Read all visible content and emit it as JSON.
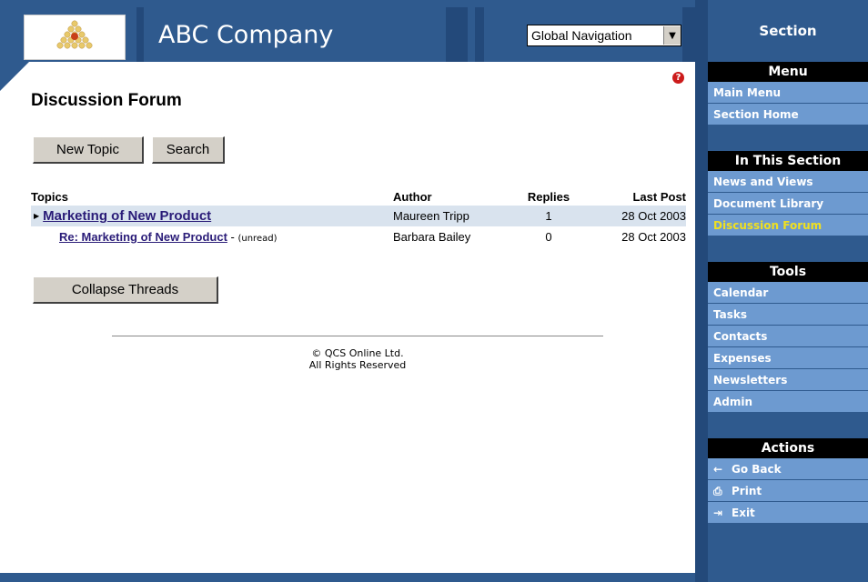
{
  "header": {
    "title": "ABC Company",
    "global_nav": {
      "selected": "Global Navigation"
    }
  },
  "page": {
    "title": "Discussion Forum",
    "buttons": {
      "new_topic": "New Topic",
      "search": "Search",
      "collapse": "Collapse Threads"
    }
  },
  "topics_table": {
    "headers": {
      "topics": "Topics",
      "author": "Author",
      "replies": "Replies",
      "last_post": "Last Post"
    },
    "rows": [
      {
        "title": "Marketing of New Product",
        "note": "",
        "author": "Maureen Tripp",
        "replies": "1",
        "last_post": "28 Oct 2003"
      },
      {
        "title": "Re: Marketing of New Product",
        "note": "(unread)",
        "author": "Barbara Bailey",
        "replies": "0",
        "last_post": "28 Oct 2003"
      }
    ]
  },
  "footer": {
    "line1": "© QCS Online Ltd.",
    "line2": "All Rights Reserved"
  },
  "sidebar": {
    "section": "Section",
    "menu": {
      "heading": "Menu",
      "items": [
        "Main Menu",
        "Section Home"
      ]
    },
    "in_section": {
      "heading": "In This Section",
      "items": [
        "News and Views",
        "Document Library",
        "Discussion Forum"
      ]
    },
    "tools": {
      "heading": "Tools",
      "items": [
        "Calendar",
        "Tasks",
        "Contacts",
        "Expenses",
        "Newsletters",
        "Admin"
      ]
    },
    "actions": {
      "heading": "Actions",
      "items": [
        "Go Back",
        "Print",
        "Exit"
      ]
    }
  },
  "colors": {
    "header_blue": "#2f5a8e",
    "sidebar_item": "#6d9ad0",
    "current_item": "#f0e020",
    "link": "#2a1c78"
  }
}
